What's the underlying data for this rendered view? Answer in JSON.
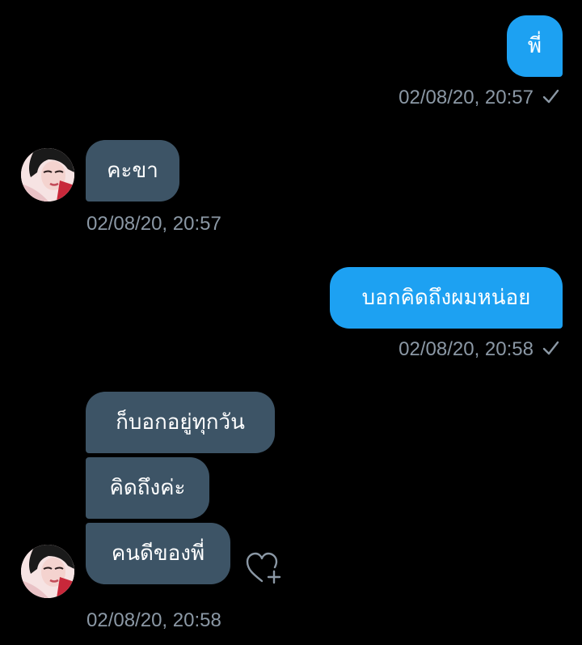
{
  "conversation": {
    "messages": [
      {
        "direction": "outgoing",
        "text": "พี่",
        "timestamp": "02/08/20, 20:57",
        "status": "sent"
      },
      {
        "direction": "incoming",
        "text": "คะขา",
        "timestamp": "02/08/20, 20:57"
      },
      {
        "direction": "outgoing",
        "text": "บอกคิดถึงผมหน่อย",
        "timestamp": "02/08/20, 20:58",
        "status": "sent"
      },
      {
        "direction": "incoming",
        "text": "ก็บอกอยู่ทุกวัน"
      },
      {
        "direction": "incoming",
        "text": "คิดถึงค่ะ"
      },
      {
        "direction": "incoming",
        "text": "คนดีของพี่",
        "timestamp": "02/08/20, 20:58"
      }
    ]
  },
  "icons": {
    "sent_status": "checkmark-icon",
    "react": "heart-plus-icon",
    "avatar": "avatar"
  },
  "colors": {
    "background": "#000000",
    "outgoing_bubble": "#1da1f2",
    "incoming_bubble": "#3d5466",
    "timestamp": "#8b98a5",
    "text": "#ffffff"
  }
}
